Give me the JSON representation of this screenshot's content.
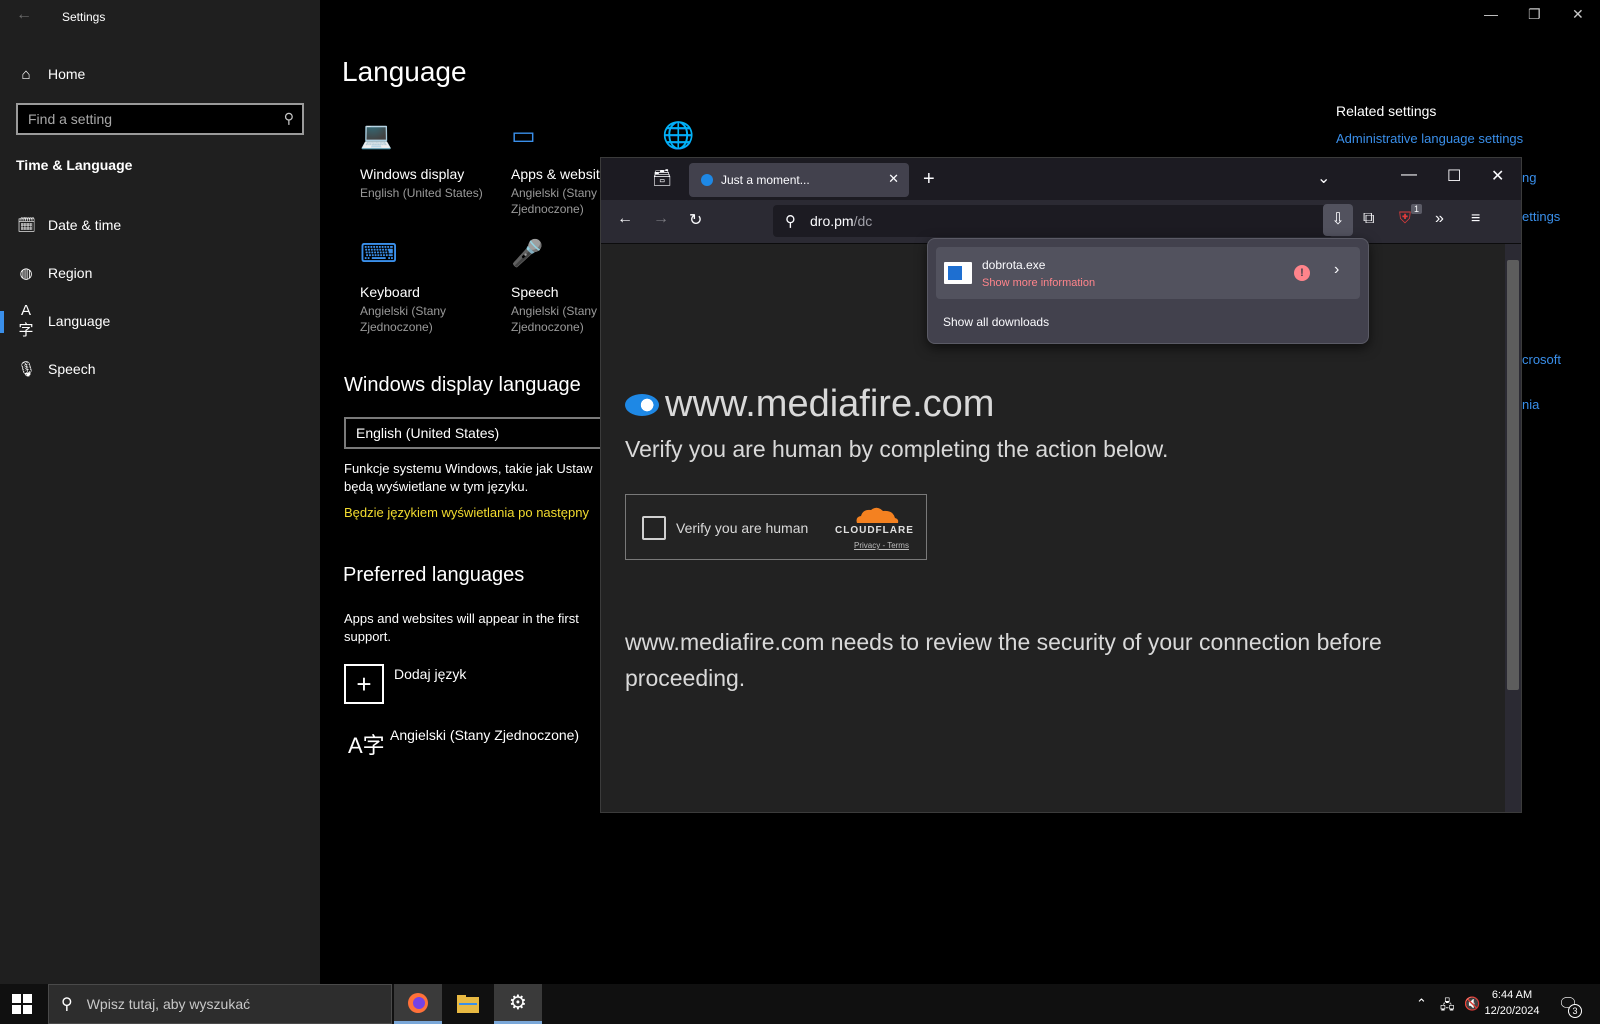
{
  "settings": {
    "window_title": "Settings",
    "search_placeholder": "Find a setting",
    "home": "Home",
    "section": "Time & Language",
    "nav": [
      {
        "label": "Date & time"
      },
      {
        "label": "Region"
      },
      {
        "label": "Language"
      },
      {
        "label": "Speech"
      }
    ],
    "page_title": "Language",
    "tiles": [
      {
        "name": "Windows display",
        "sub": "English (United States)"
      },
      {
        "name": "Apps & websit",
        "sub": "Angielski (Stany Zjednoczone)"
      },
      {
        "name": "Keyboard",
        "sub": "Angielski (Stany Zjednoczone)"
      },
      {
        "name": "Speech",
        "sub": "Angielski (Stany Zjednoczone)"
      }
    ],
    "display_language_heading": "Windows display language",
    "display_language_value": "English (United States)",
    "display_language_desc_1": "Funkcje systemu Windows, takie jak Ustaw",
    "display_language_desc_2": "będą wyświetlane w tym języku.",
    "display_language_warning": "Będzie językiem wyświetlania po następny",
    "preferred_heading": "Preferred languages",
    "preferred_desc_1": "Apps and websites will appear in the first",
    "preferred_desc_2": "support.",
    "add_language": "Dodaj język",
    "installed_language": "Angielski (Stany Zjednoczone)",
    "related_title": "Related settings",
    "related_links": [
      "Administrative language settings",
      "ng",
      "ettings",
      "crosoft",
      "nia"
    ]
  },
  "firefox": {
    "tab_title": "Just a moment...",
    "url_host": "dro.pm",
    "url_path": "/dc",
    "extension_badge": "1",
    "download": {
      "filename": "dobrota.exe",
      "info": "Show more information",
      "show_all": "Show all downloads"
    },
    "page": {
      "site_name": "www.mediafire.com",
      "verify_heading": "Verify you are human by completing the action below.",
      "checkbox_label": "Verify you are human",
      "cf_brand": "CLOUDFLARE",
      "cf_links": "Privacy - Terms",
      "review_text": "www.mediafire.com needs to review the security of your connection before proceeding."
    }
  },
  "taskbar": {
    "search_placeholder": "Wpisz tutaj, aby wyszukać",
    "time": "6:44 AM",
    "date": "12/20/2024",
    "notification_count": "3"
  },
  "colors": {
    "accent": "#3a8fea",
    "warning": "#f3dc2f",
    "cloudflare_orange": "#f48120",
    "download_warning": "#ff848b"
  }
}
